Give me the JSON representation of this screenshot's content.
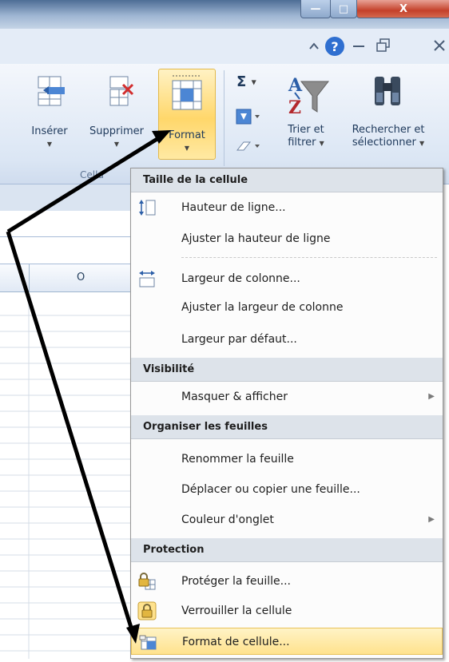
{
  "window": {
    "minimize_glyph": "—",
    "maximize_glyph": "□",
    "close_glyph": "X"
  },
  "ribbon": {
    "insert_label": "Insérer",
    "delete_label": "Supprimer",
    "format_label": "Format",
    "group_label": "Cellu",
    "sort_label_line1": "Trier et",
    "sort_label_line2": "filtrer",
    "find_label_line1": "Rechercher et",
    "find_label_line2": "sélectionner",
    "sigma": "Σ",
    "dropdown": "▼"
  },
  "grid": {
    "column_header": "O"
  },
  "menu": {
    "sections": [
      {
        "header": "Taille de la cellule",
        "items": [
          {
            "label": "Hauteur de ligne...",
            "icon": "row-height-icon"
          },
          {
            "label": "Ajuster la hauteur de ligne",
            "icon": ""
          },
          {
            "label": "Largeur de colonne...",
            "icon": "column-width-icon"
          },
          {
            "label": "Ajuster la largeur de colonne",
            "icon": ""
          },
          {
            "label": "Largeur par défaut...",
            "icon": ""
          }
        ]
      },
      {
        "header": "Visibilité",
        "items": [
          {
            "label": "Masquer & afficher",
            "icon": "",
            "submenu": true
          }
        ]
      },
      {
        "header": "Organiser les feuilles",
        "items": [
          {
            "label": "Renommer la feuille",
            "icon": ""
          },
          {
            "label": "Déplacer ou copier une feuille...",
            "icon": ""
          },
          {
            "label": "Couleur d'onglet",
            "icon": "",
            "submenu": true
          }
        ]
      },
      {
        "header": "Protection",
        "items": [
          {
            "label": "Protéger la feuille...",
            "icon": "protect-sheet-icon"
          },
          {
            "label": "Verrouiller la cellule",
            "icon": "lock-icon"
          },
          {
            "label": "Format de cellule...",
            "icon": "format-cells-icon",
            "highlighted": true
          }
        ]
      }
    ],
    "submenu_arrow": "▶"
  },
  "colors": {
    "highlight": "#ffe28d",
    "header_bg": "#dde3ea",
    "ribbon_text": "#1e395b",
    "help_icon": "#2f6fd0"
  }
}
